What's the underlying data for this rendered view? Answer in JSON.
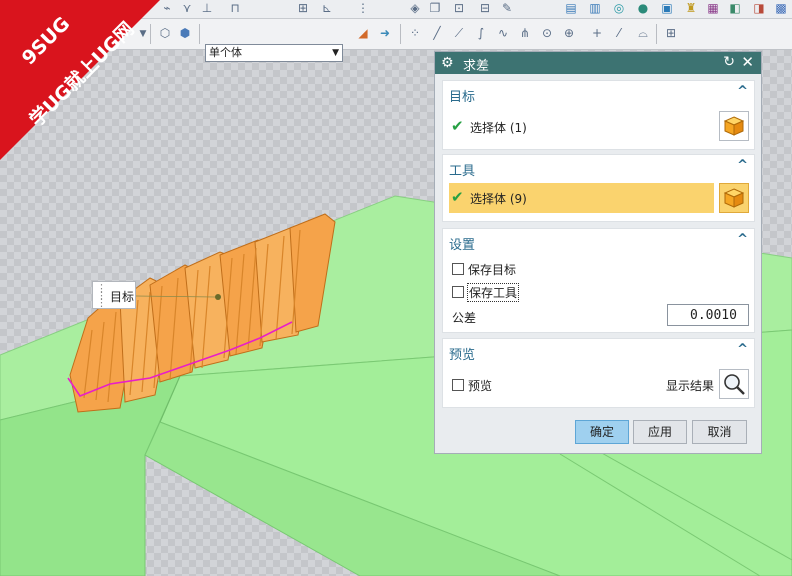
{
  "watermark": {
    "line1": "9SUG",
    "line2": "学UG就上UG网"
  },
  "toolbar": {
    "body_type_select": "单个体"
  },
  "tag": {
    "label": "目标"
  },
  "dialog": {
    "title": "求差",
    "target": {
      "header": "目标",
      "selection": "选择体 (1)"
    },
    "tool": {
      "header": "工具",
      "selection": "选择体 (9)"
    },
    "settings": {
      "header": "设置",
      "keep_target": "保存目标",
      "keep_tool": "保存工具",
      "tolerance_label": "公差",
      "tolerance_value": "0.0010"
    },
    "preview": {
      "header": "预览",
      "preview_label": "预览",
      "show_result": "显示结果"
    },
    "buttons": {
      "ok": "确定",
      "apply": "应用",
      "cancel": "取消"
    }
  },
  "colors": {
    "dialog_title": "#3d7372",
    "header_text": "#2a6b8d",
    "selected_row": "#fad36e",
    "ok_button": "#9fd0ef",
    "solid_green": "#9fea97",
    "body_orange": "#f5a34a",
    "edge_magenta": "#e81ec9",
    "watermark_red": "#d9141d"
  }
}
